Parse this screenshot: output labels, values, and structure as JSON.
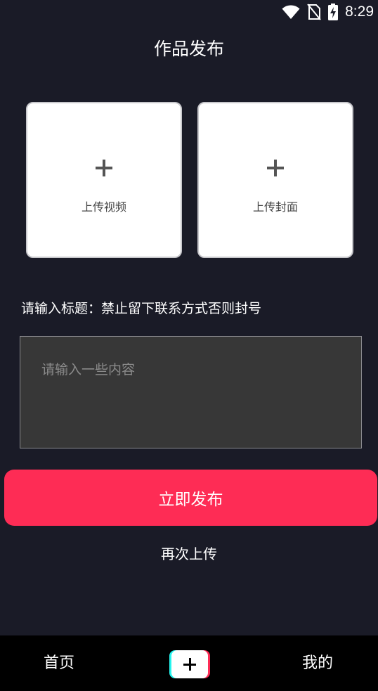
{
  "status_bar": {
    "time": "8:29",
    "icons": [
      "wifi-icon",
      "no-sim-icon",
      "battery-charging-icon"
    ]
  },
  "page": {
    "title": "作品发布"
  },
  "upload": {
    "video_label": "上传视频",
    "cover_label": "上传封面",
    "icon": "plus-icon"
  },
  "form": {
    "title_hint": "请输入标题：禁止留下联系方式否则封号",
    "content_placeholder": "请输入一些内容",
    "content_value": ""
  },
  "actions": {
    "publish_label": "立即发布",
    "reupload_label": "再次上传"
  },
  "bottom_nav": {
    "home_label": "首页",
    "add_icon": "add-video-icon",
    "mine_label": "我的"
  },
  "colors": {
    "background": "#1a1b27",
    "accent": "#fe2c55",
    "accent_secondary": "#25f4ee",
    "nav_background": "#000000",
    "card_background": "#ffffff",
    "input_background": "#373737"
  }
}
